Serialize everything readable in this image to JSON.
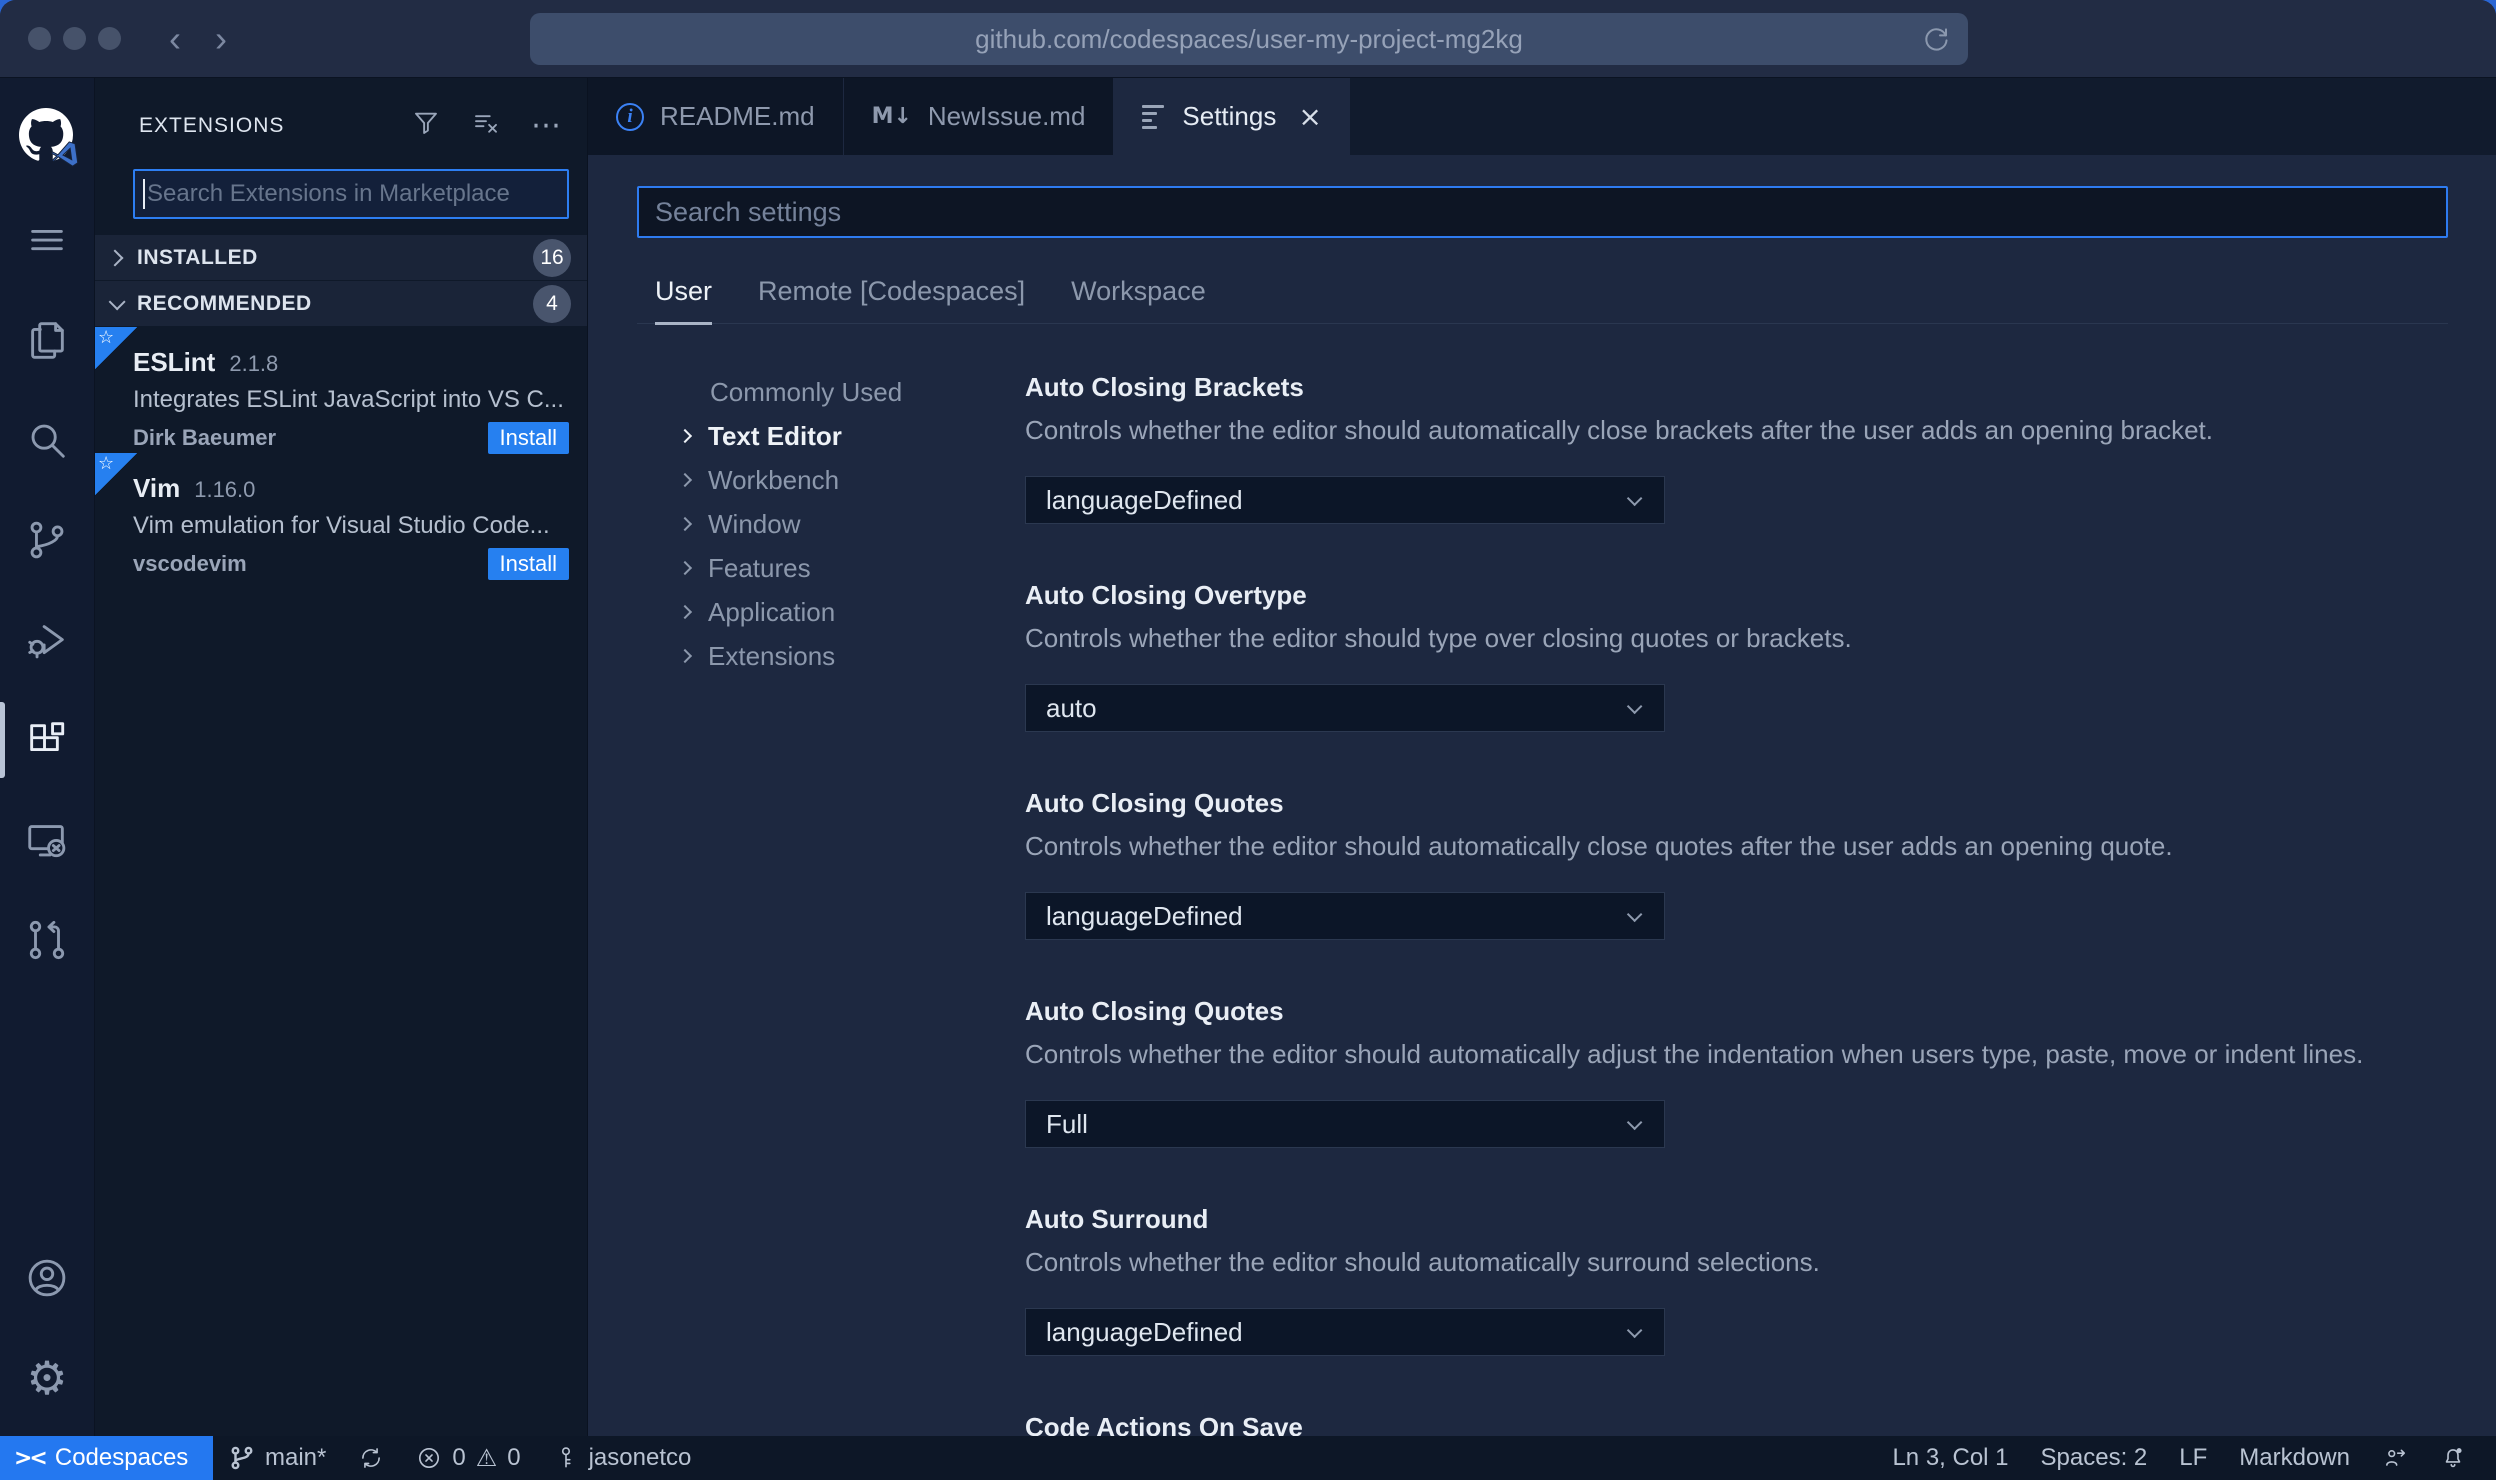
{
  "browser": {
    "url": "github.com/codespaces/user-my-project-mg2kg"
  },
  "icons": {
    "ellipsis": "⋯",
    "gear": "⚙",
    "star": "☆",
    "markdown": "M↓",
    "remote": "><",
    "warning": "⚠",
    "close": "×"
  },
  "colors": {
    "accent_blue": "#2680f0",
    "focus_border": "#2e7bf0",
    "statusbar_remote_bg": "#2478f0",
    "editor_bg": "#1d2840",
    "sidebar_bg": "#0f1929",
    "titlebar_bg": "#222c44"
  },
  "activity_bar": {
    "items": [
      {
        "icon": "menu-icon"
      },
      {
        "icon": "explorer-icon"
      },
      {
        "icon": "search-icon"
      },
      {
        "icon": "source-control-icon"
      },
      {
        "icon": "run-debug-icon"
      },
      {
        "icon": "extensions-icon",
        "active": true
      },
      {
        "icon": "remote-explorer-icon"
      },
      {
        "icon": "pull-request-icon"
      },
      {
        "icon": "account-icon"
      },
      {
        "icon": "settings-gear-icon"
      }
    ]
  },
  "sidebar": {
    "title": "EXTENSIONS",
    "search_placeholder": "Search Extensions in Marketplace",
    "sections": [
      {
        "label": "INSTALLED",
        "count": "16"
      },
      {
        "label": "RECOMMENDED",
        "count": "4"
      }
    ],
    "extensions": [
      {
        "name": "ESLint",
        "version": "2.1.8",
        "description": "Integrates ESLint JavaScript into VS C...",
        "publisher": "Dirk Baeumer",
        "action": "Install"
      },
      {
        "name": "Vim",
        "version": "1.16.0",
        "description": "Vim emulation for Visual Studio Code...",
        "publisher": "vscodevim",
        "action": "Install"
      }
    ]
  },
  "tabs": [
    {
      "label": "README.md",
      "icon": "info-icon"
    },
    {
      "label": "NewIssue.md",
      "icon": "markdown-icon"
    },
    {
      "label": "Settings",
      "icon": "settings-editor-icon",
      "active": true
    }
  ],
  "settings": {
    "search_placeholder": "Search settings",
    "scopes": [
      {
        "label": "User",
        "active": true
      },
      {
        "label": "Remote [Codespaces]"
      },
      {
        "label": "Workspace"
      }
    ],
    "toc": [
      {
        "label": "Commonly Used"
      },
      {
        "label": "Text Editor",
        "active": true
      },
      {
        "label": "Workbench"
      },
      {
        "label": "Window"
      },
      {
        "label": "Features"
      },
      {
        "label": "Application"
      },
      {
        "label": "Extensions"
      }
    ],
    "entries": [
      {
        "title": "Auto Closing Brackets",
        "description": "Controls whether the editor should automatically close brackets after the user adds an opening bracket.",
        "value": "languageDefined"
      },
      {
        "title": "Auto Closing Overtype",
        "description": "Controls whether the editor should type over closing quotes or brackets.",
        "value": "auto"
      },
      {
        "title": "Auto Closing Quotes",
        "description": "Controls whether the editor should automatically close quotes after the user adds an opening quote.",
        "value": "languageDefined"
      },
      {
        "title": "Auto Closing Quotes",
        "description": "Controls whether the editor should automatically adjust the indentation when users type, paste, move or indent lines.",
        "value": "Full"
      },
      {
        "title": "Auto Surround",
        "description": "Controls whether the editor should automatically surround selections.",
        "value": "languageDefined"
      },
      {
        "title": "Code Actions On Save"
      }
    ]
  },
  "status_bar": {
    "remote_label": "Codespaces",
    "branch": "main*",
    "error_count": "0",
    "warning_count": "0",
    "user": "jasonetco",
    "line_col": "Ln 3, Col 1",
    "spaces": "Spaces: 2",
    "eol": "LF",
    "language": "Markdown"
  }
}
